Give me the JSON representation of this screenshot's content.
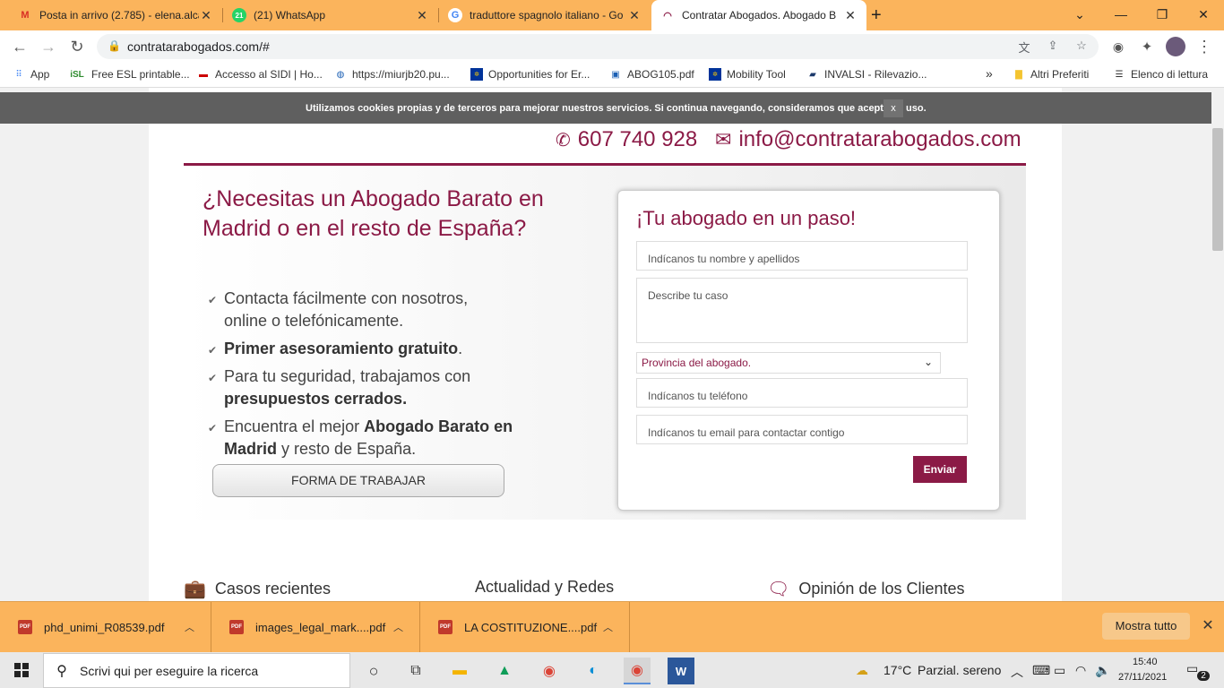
{
  "browser": {
    "tabs": [
      {
        "title": "Posta in arrivo (2.785) - elena.alca",
        "icon": "gmail-icon",
        "active": false
      },
      {
        "title": "(21) WhatsApp",
        "icon": "whatsapp-icon",
        "badge": "21",
        "active": false
      },
      {
        "title": "traduttore spagnolo italiano - Go",
        "icon": "google-icon",
        "active": false
      },
      {
        "title": "Contratar Abogados. Abogado B",
        "icon": "site-icon",
        "active": true
      }
    ],
    "new_tab_glyph": "+",
    "url": "contratarabogados.com/#",
    "bookmarks": [
      {
        "label": "App",
        "icon": "apps-icon"
      },
      {
        "label": "Free ESL printable...",
        "icon": "isl-icon",
        "prefix": "iSL"
      },
      {
        "label": "Accesso al SIDI | Ho...",
        "icon": "sidi-icon"
      },
      {
        "label": "https://miurjb20.pu...",
        "icon": "globe-icon"
      },
      {
        "label": "Opportunities for Er...",
        "icon": "eu-flag-icon"
      },
      {
        "label": "ABOG105.pdf",
        "icon": "pdf-file-icon"
      },
      {
        "label": "Mobility Tool",
        "icon": "eu-flag-icon"
      },
      {
        "label": "INVALSI - Rilevazio...",
        "icon": "bookmark-icon"
      }
    ],
    "bookmarks_overflow": "»",
    "other_bookmarks": "Altri Preferiti",
    "reading_list": "Elenco di lettura"
  },
  "page": {
    "cookie_notice": "Utilizamos cookies propias y de terceros para mejorar nuestros servicios. Si continua navegando, consideramos que acepta su uso.",
    "cookie_close": "x",
    "phone": "607 740 928",
    "email": "info@contratarabogados.com",
    "headline": "¿Necesitas un Abogado Barato en Madrid o en el resto de España?",
    "bullets": [
      {
        "t1": "Contacta fácilmente con nosotros, online o telefónicamente.",
        "b": "",
        "t2": ""
      },
      {
        "t1": "",
        "b": "Primer asesoramiento gratuito",
        "t2": "."
      },
      {
        "t1": "Para tu seguridad, trabajamos con ",
        "b": "presupuestos cerrados.",
        "t2": ""
      },
      {
        "t1": "Encuentra el mejor ",
        "b": "Abogado Barato en Madrid",
        "t2": " y resto de España."
      }
    ],
    "forma_button": "FORMA DE TRABAJAR",
    "form": {
      "title": "¡Tu abogado en un paso!",
      "name_placeholder": "Indícanos tu nombre y apellidos",
      "case_placeholder": "Describe tu caso",
      "province_selected": "Provincia del abogado.",
      "phone_placeholder": "Indícanos tu teléfono",
      "email_placeholder": "Indícanos tu email para contactar contigo",
      "submit": "Enviar"
    },
    "sections": [
      "Casos recientes",
      "Actualidad y Redes",
      "Opinión de los Clientes"
    ],
    "accent_color": "#8b1a46"
  },
  "downloads": {
    "items": [
      "phd_unimi_R08539.pdf",
      "images_legal_mark....pdf",
      "LA COSTITUZIONE....pdf"
    ],
    "show_all": "Mostra tutto"
  },
  "taskbar": {
    "search_placeholder": "Scrivi qui per eseguire la ricerca",
    "weather_temp": "17°C",
    "weather_desc": "Parzial. sereno",
    "time": "15:40",
    "date": "27/11/2021",
    "notifications": "2"
  }
}
